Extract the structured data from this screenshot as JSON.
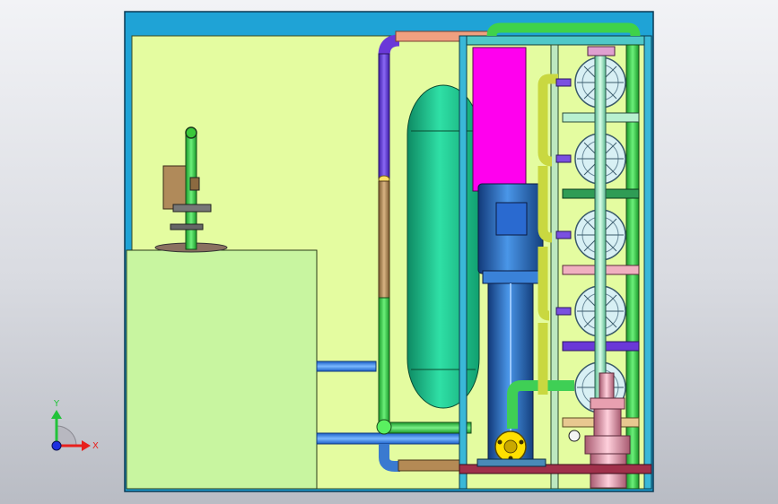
{
  "viewport": {
    "background_top": "#f2f3f6",
    "background_bottom": "#b9bcc4"
  },
  "triad": {
    "x_label": "X",
    "y_label": "Y",
    "x_color": "#e8201c",
    "y_color": "#22c33a",
    "z_color": "#1d2fe0"
  },
  "model": {
    "frame_color": "#1fa3d6",
    "wall_color": "#e4fca0",
    "tank_color": "#1fc08a",
    "cabinet_color": "#c8f5a0",
    "motor_color": "#2f73c8",
    "panel_color": "#ff00ee",
    "pipe_green": "#2fd23a",
    "pipe_purple": "#6a38d8",
    "pipe_tan": "#b48a55",
    "pipe_blue": "#2f78e0",
    "pipe_salmon": "#f0a080",
    "flange_yellow": "#ffe000",
    "valve_pink": "#e8a0b0"
  }
}
